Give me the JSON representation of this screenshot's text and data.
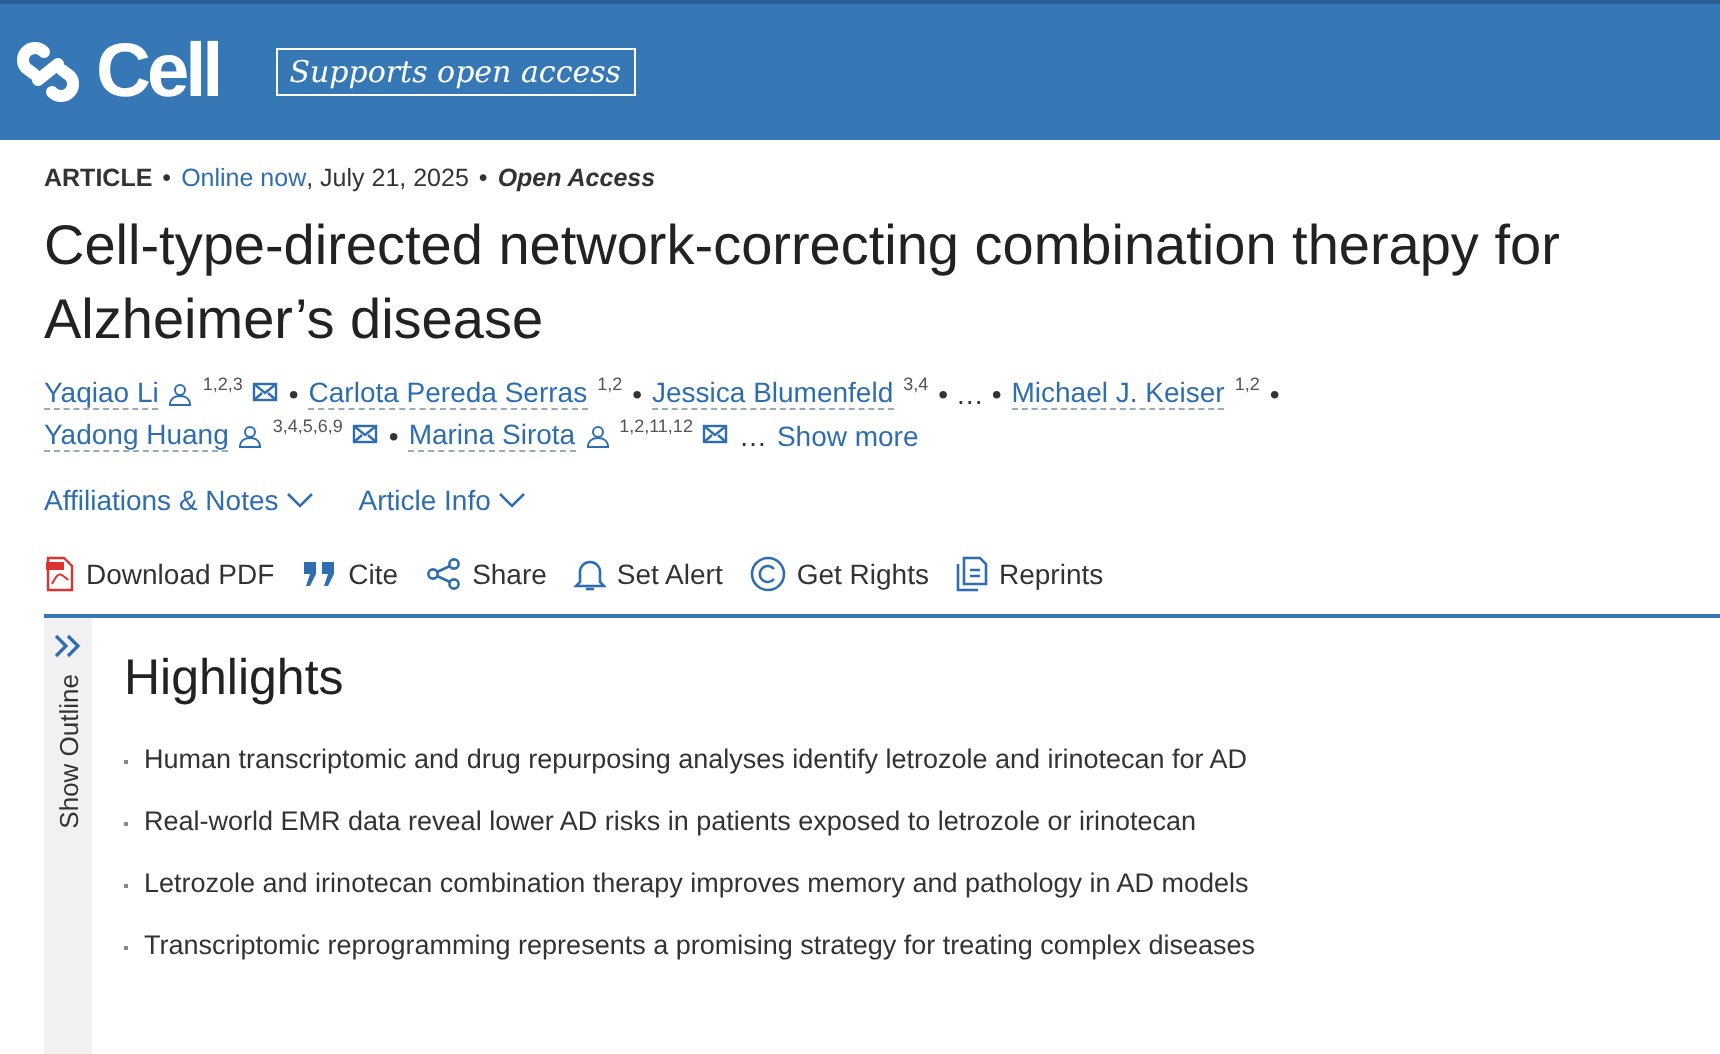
{
  "header": {
    "logo": "Cell",
    "badge": "Supports open access"
  },
  "meta": {
    "type": "ARTICLE",
    "sep1": "•",
    "online": "Online now",
    "date": ", July 21, 2025",
    "sep2": "•",
    "access": "Open Access"
  },
  "title": "Cell-type-directed network-correcting combination therapy for Alzheimer’s disease",
  "author_lines": [
    [
      {
        "kind": "author",
        "name": "Yaqiao Li",
        "person": true,
        "sup": "1,2,3",
        "mail": true
      },
      {
        "kind": "text",
        "text": "•"
      },
      {
        "kind": "author",
        "name": "Carlota Pereda Serras",
        "person": false,
        "sup": "1,2",
        "mail": false
      },
      {
        "kind": "text",
        "text": "•"
      },
      {
        "kind": "author",
        "name": "Jessica Blumenfeld",
        "person": false,
        "sup": "3,4",
        "mail": false
      },
      {
        "kind": "text",
        "text": "• … •"
      },
      {
        "kind": "author",
        "name": "Michael J. Keiser",
        "person": false,
        "sup": "1,2",
        "mail": false
      },
      {
        "kind": "text",
        "text": "•"
      }
    ],
    [
      {
        "kind": "author",
        "name": "Yadong Huang",
        "person": true,
        "sup": "3,4,5,6,9",
        "mail": true
      },
      {
        "kind": "text",
        "text": "•"
      },
      {
        "kind": "author",
        "name": "Marina Sirota",
        "person": true,
        "sup": "1,2,11,12",
        "mail": true
      },
      {
        "kind": "text",
        "text": "…"
      },
      {
        "kind": "link",
        "text": "Show more"
      }
    ]
  ],
  "info_links": [
    "Affiliations & Notes",
    "Article Info"
  ],
  "actions": [
    {
      "kind": "pdf",
      "label": "Download PDF"
    },
    {
      "kind": "cite",
      "label": "Cite"
    },
    {
      "kind": "share",
      "label": "Share"
    },
    {
      "kind": "alert",
      "label": "Set Alert"
    },
    {
      "kind": "rights",
      "label": "Get Rights"
    },
    {
      "kind": "reprints",
      "label": "Reprints"
    }
  ],
  "outline": {
    "label": "Show Outline"
  },
  "highlights": {
    "heading": "Highlights",
    "items": [
      "Human transcriptomic and drug repurposing analyses identify letrozole and irinotecan for AD",
      "Real-world EMR data reveal lower AD risks in patients exposed to letrozole or irinotecan",
      "Letrozole and irinotecan combination therapy improves memory and pathology in AD models",
      "Transcriptomic reprogramming represents a promising strategy for treating complex diseases"
    ]
  }
}
